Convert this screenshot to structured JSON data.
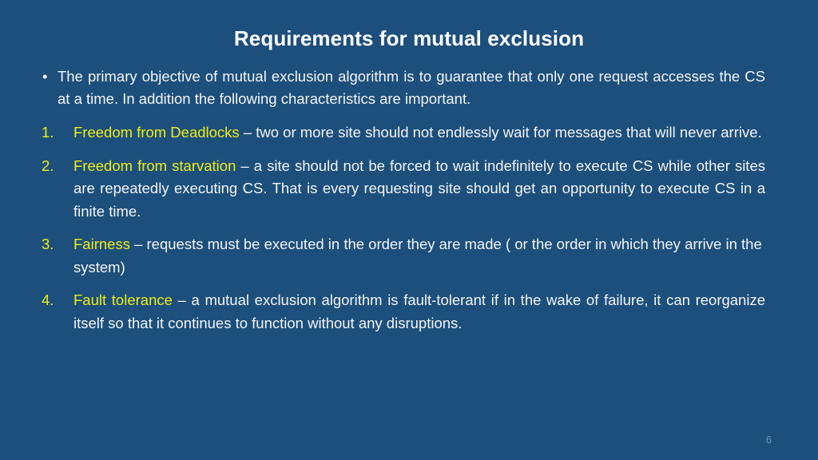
{
  "slide": {
    "background_color": "#1d4f7c",
    "title": "Requirements for mutual exclusion",
    "intro": {
      "bullet_glyph": "•",
      "text": "The primary objective of mutual exclusion algorithm is to guarantee that only one request accesses the CS at a time. In addition the following characteristics are important."
    },
    "items": [
      {
        "number": "1.",
        "term": "Freedom from Deadlocks",
        "rest": " – two or more site should not endlessly wait for messages that will never arrive."
      },
      {
        "number": "2.",
        "term": "Freedom from starvation",
        "rest": " – a site should not be forced to wait indefinitely to execute CS while other sites are repeatedly executing CS. That is every requesting site should get an opportunity to execute CS in a finite time."
      },
      {
        "number": "3.",
        "term": "Fairness",
        "rest": " – requests must be executed in the order they are made ( or the order in which they arrive in the system)"
      },
      {
        "number": "4.",
        "term": "Fault tolerance",
        "rest": " – a mutual exclusion algorithm is fault-tolerant if in the wake of failure, it can reorganize itself so that it continues to function without any disruptions."
      }
    ],
    "page_number": "6",
    "colors": {
      "highlight": "#eded17",
      "body_text": "#f2f5f8",
      "page_number": "#6f93b3"
    }
  }
}
